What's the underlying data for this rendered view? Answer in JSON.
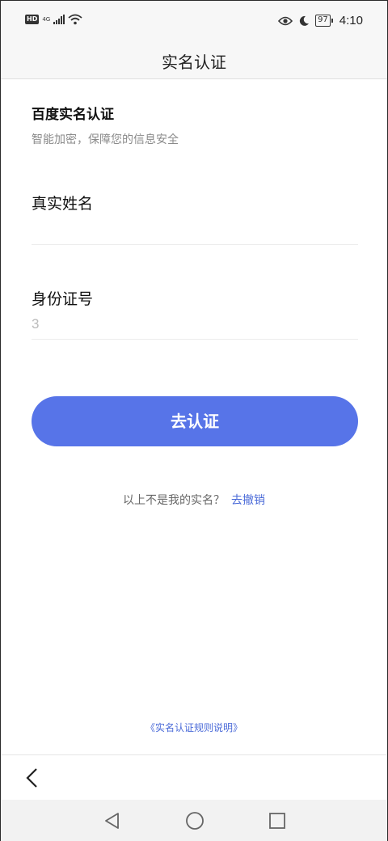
{
  "status_bar": {
    "left_badge": "HD",
    "network": "4G",
    "battery": "97",
    "time": "4:10"
  },
  "header": {
    "title": "实名认证"
  },
  "section": {
    "title": "百度实名认证",
    "subtitle": "智能加密，保障您的信息安全"
  },
  "form": {
    "name_label": "真实姓名",
    "name_value": "",
    "id_label": "身份证号",
    "id_value": "3",
    "submit_label": "去认证"
  },
  "not_me": {
    "question": "以上不是我的实名？",
    "revoke_link": "去撤销"
  },
  "rules_link": "《实名认证规则说明》",
  "icons": [
    "eye-icon",
    "moon-icon",
    "wifi-icon",
    "signal-icon",
    "back-arrow-icon",
    "nav-back-icon",
    "nav-home-icon",
    "nav-recents-icon"
  ]
}
